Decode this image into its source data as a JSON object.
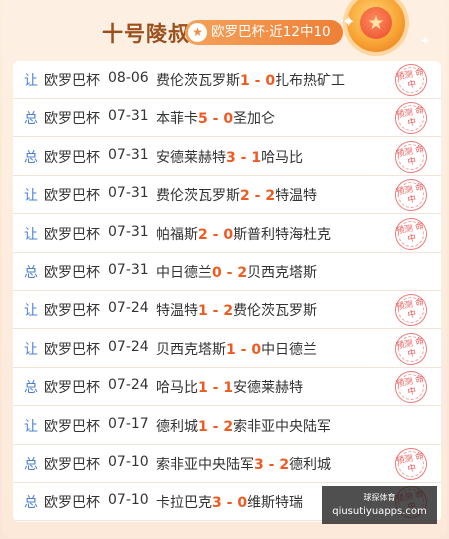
{
  "header": {
    "title": "十号陵叔",
    "badge_icon": "star",
    "badge": "欧罗巴杯·近12中10",
    "medal_icon": "star-medal"
  },
  "colors": {
    "accent": "#ef7f36",
    "title": "#9a4f1c",
    "type_label": "#4a7fd9",
    "score": "#ee5a1f",
    "stamp": "#ea5a5a"
  },
  "rows": [
    {
      "type": "让",
      "comp": "欧罗巴杯",
      "date": "08-06",
      "home": "费伦茨瓦罗斯",
      "hs": "1",
      "sep": " - ",
      "as": "0",
      "away": "扎布热矿工",
      "stamp": "预测 命中",
      "hit": true
    },
    {
      "type": "总",
      "comp": "欧罗巴杯",
      "date": "07-31",
      "home": "本菲卡",
      "hs": "5",
      "sep": " - ",
      "as": "0",
      "away": "圣加仑",
      "stamp": "预测 命中",
      "hit": true
    },
    {
      "type": "总",
      "comp": "欧罗巴杯",
      "date": "07-31",
      "home": "安德莱赫特",
      "hs": "3",
      "sep": " - ",
      "as": "1",
      "away": "哈马比",
      "stamp": "预测 命中",
      "hit": true
    },
    {
      "type": "让",
      "comp": "欧罗巴杯",
      "date": "07-31",
      "home": "费伦茨瓦罗斯",
      "hs": "2",
      "sep": " - ",
      "as": "2",
      "away": "特温特",
      "stamp": "预测 命中",
      "hit": true
    },
    {
      "type": "让",
      "comp": "欧罗巴杯",
      "date": "07-31",
      "home": "帕福斯",
      "hs": "2",
      "sep": " - ",
      "as": "0",
      "away": "斯普利特海杜克",
      "stamp": "预测 命中",
      "hit": true
    },
    {
      "type": "总",
      "comp": "欧罗巴杯",
      "date": "07-31",
      "home": "中日德兰",
      "hs": "0",
      "sep": " - ",
      "as": "2",
      "away": "贝西克塔斯",
      "stamp": "",
      "hit": false
    },
    {
      "type": "让",
      "comp": "欧罗巴杯",
      "date": "07-24",
      "home": "特温特",
      "hs": "1",
      "sep": " - ",
      "as": "2",
      "away": "费伦茨瓦罗斯",
      "stamp": "预测 命中",
      "hit": true
    },
    {
      "type": "让",
      "comp": "欧罗巴杯",
      "date": "07-24",
      "home": "贝西克塔斯",
      "hs": "1",
      "sep": " - ",
      "as": "0",
      "away": "中日德兰",
      "stamp": "预测 命中",
      "hit": true
    },
    {
      "type": "总",
      "comp": "欧罗巴杯",
      "date": "07-24",
      "home": "哈马比",
      "hs": "1",
      "sep": " - ",
      "as": "1",
      "away": "安德莱赫特",
      "stamp": "预测 命中",
      "hit": true
    },
    {
      "type": "让",
      "comp": "欧罗巴杯",
      "date": "07-17",
      "home": "德利城",
      "hs": "1",
      "sep": " - ",
      "as": "2",
      "away": "索非亚中央陆军",
      "stamp": "",
      "hit": false
    },
    {
      "type": "总",
      "comp": "欧罗巴杯",
      "date": "07-10",
      "home": "索非亚中央陆军",
      "hs": "3",
      "sep": " - ",
      "as": "2",
      "away": "德利城",
      "stamp": "预测 命中",
      "hit": true
    },
    {
      "type": "总",
      "comp": "欧罗巴杯",
      "date": "07-10",
      "home": "卡拉巴克",
      "hs": "3",
      "sep": " - ",
      "as": "0",
      "away": "维斯特瑞",
      "stamp": "预测 命中",
      "hit": true
    }
  ],
  "watermark": {
    "line1": "球探体育",
    "line2": "qiusutiyuapps.com"
  }
}
